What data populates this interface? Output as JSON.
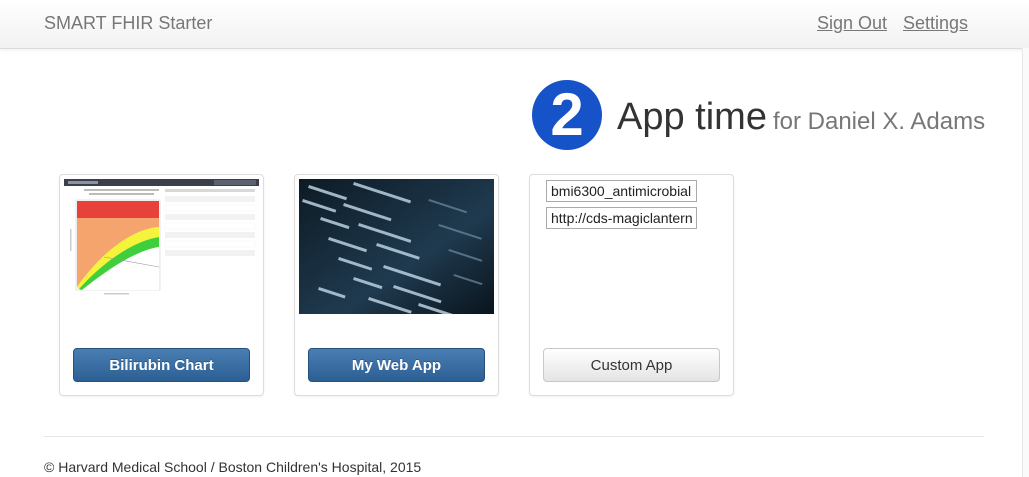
{
  "navbar": {
    "brand": "SMART FHIR Starter",
    "links": [
      {
        "label": "Sign Out"
      },
      {
        "label": "Settings"
      }
    ]
  },
  "header": {
    "step_number": "2",
    "title": "App time",
    "subtitle": "for Daniel X. Adams",
    "accent_color": "#1652c8"
  },
  "cards": [
    {
      "button_label": "Bilirubin Chart",
      "thumbnail": "bilirubin-chart-thumbnail"
    },
    {
      "button_label": "My Web App",
      "thumbnail": "code-screen-thumbnail"
    },
    {
      "button_label": "Custom App",
      "fields": [
        {
          "value": "bmi6300_antimicrobial"
        },
        {
          "value": "http://cds-magiclantern"
        }
      ]
    }
  ],
  "footer": {
    "text": "© Harvard Medical School / Boston Children's Hospital, 2015"
  },
  "colors": {
    "primary_button": "#2c5f92",
    "chart_red": "#e8413c",
    "chart_orange": "#f4a46c",
    "chart_yellow": "#f5f33a",
    "chart_green": "#3fcf3a"
  }
}
